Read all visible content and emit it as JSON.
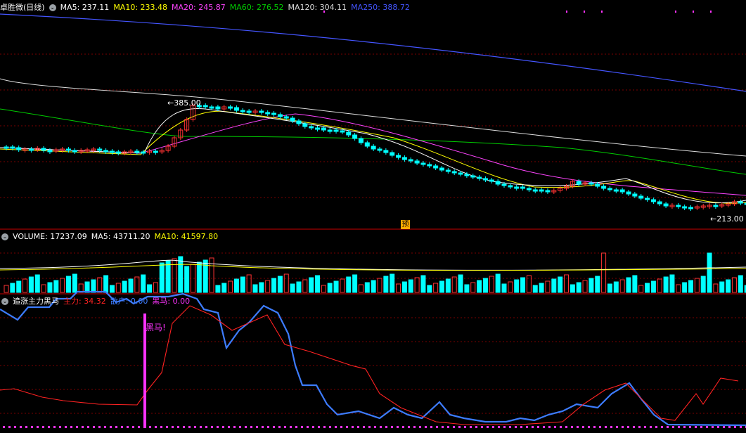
{
  "main": {
    "title": "卓胜微(日线)",
    "ma": [
      {
        "label": "MA5: 237.11",
        "color": "#ffffff"
      },
      {
        "label": "MA10: 233.48",
        "color": "#ffff00"
      },
      {
        "label": "MA20: 245.87",
        "color": "#ff44ff"
      },
      {
        "label": "MA60: 276.52",
        "color": "#00cc00"
      },
      {
        "label": "MA120: 304.11",
        "color": "#dddddd"
      },
      {
        "label": "MA250: 388.72",
        "color": "#4455ff"
      }
    ],
    "high_label": "385.00",
    "low_label": "213.00",
    "forecast_badge": "预"
  },
  "volume": {
    "title": "VOLUME: 17237.09",
    "ma5": "MA5: 43711.20",
    "ma10": "MA10: 41597.80"
  },
  "indicator": {
    "title": "追涨主力黑马",
    "main_force": "主力: 34.32",
    "retail": "散户: 0.00",
    "dark_horse": "黑马: 0.00",
    "signal_label": "黑马!"
  },
  "colors": {
    "up": "#ff3333",
    "down": "#00ffff",
    "grid": "#7a0000",
    "border": "#cc0000",
    "ma5": "#ffffff",
    "ma10": "#ffff00",
    "ma20": "#ff44ff",
    "ma60": "#00cc00",
    "ma120": "#dddddd",
    "ma250": "#4455ff",
    "main_force": "#ff2222",
    "retail": "#3d7cff",
    "dark_horse": "#ff33ff"
  }
}
